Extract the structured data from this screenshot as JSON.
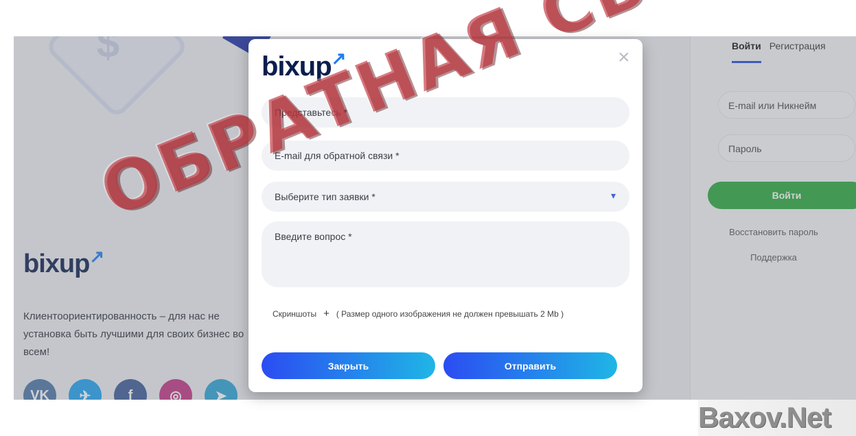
{
  "background": {
    "brand": {
      "main": "bix",
      "accent": "up"
    },
    "description": "Клиентоориентированность – для нас не установка быть лучшими для своих бизнес во всем!",
    "socials": [
      {
        "name": "vk",
        "glyph": "VK",
        "color": "#4a76a8"
      },
      {
        "name": "twitter",
        "glyph": "✈",
        "color": "#1da1f2"
      },
      {
        "name": "facebook",
        "glyph": "f",
        "color": "#3b5998"
      },
      {
        "name": "instagram",
        "glyph": "◎",
        "color": "#c13584"
      },
      {
        "name": "telegram",
        "glyph": "➤",
        "color": "#2aa3d8"
      }
    ]
  },
  "login_panel": {
    "tab_login": "Войти",
    "tab_register": "Регистрация",
    "login_placeholder": "E-mail или Никнейм",
    "password_placeholder": "Пароль",
    "login_button": "Войти",
    "restore_link": "Восстановить пароль",
    "support_link": "Поддержка"
  },
  "modal": {
    "logo": {
      "main": "bix",
      "accent": "up"
    },
    "close_glyph": "×",
    "name_placeholder": "Представьтесь *",
    "email_placeholder": "E-mail для обратной связи *",
    "type_placeholder": "Выберите тип заявки *",
    "question_placeholder": "Введите вопрос *",
    "screenshots_label": "Скриншоты",
    "screenshots_add": "+",
    "screenshots_note": "( Размер одного изображения не должен превышать 2 Mb )",
    "close_button": "Закрыть",
    "send_button": "Отправить"
  },
  "watermark": {
    "stamp_text": "ОБРАТНАЯ СВЯЗЬ",
    "site": "Baxov.Net"
  },
  "colors": {
    "brand_dark": "#0b1e4e",
    "brand_accent": "#1f7cf0",
    "login_green": "#27a83d",
    "gradient_start": "#2b4cf2",
    "gradient_end": "#1fb6e6"
  }
}
